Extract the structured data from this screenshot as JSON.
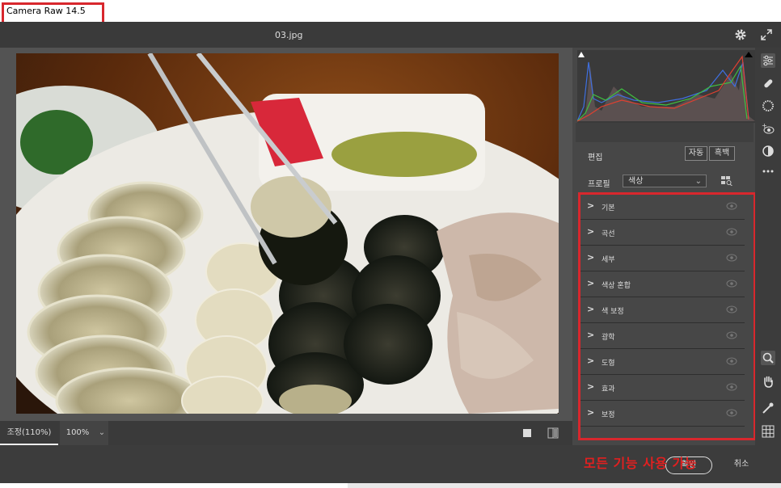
{
  "app": {
    "title": "Camera Raw 14.5"
  },
  "file": {
    "name": "03.jpg"
  },
  "zoom": {
    "label": "조정(110%)",
    "value": "100%"
  },
  "panel": {
    "edit_title": "편집",
    "auto_label": "자동",
    "bw_label": "흑백",
    "profile_label": "프로필",
    "profile_value": "색상",
    "sections": [
      "기본",
      "곡선",
      "세부",
      "색상 혼합",
      "색 보정",
      "광학",
      "도형",
      "효과",
      "보정"
    ]
  },
  "footer": {
    "ok_label": "확인",
    "cancel_label": "취소"
  },
  "annotation": "모든 기능 사용 가능",
  "colors": {
    "highlight": "#d8272d",
    "annotation": "#e02020",
    "panel_bg": "#474747"
  },
  "icons": [
    "gear-icon",
    "expand-icon",
    "edit-sliders-icon",
    "healing-icon",
    "mask-icon",
    "redeye-icon",
    "presets-icon",
    "more-icon",
    "zoom-icon",
    "hand-icon",
    "color-sampler-icon",
    "grid-icon"
  ]
}
